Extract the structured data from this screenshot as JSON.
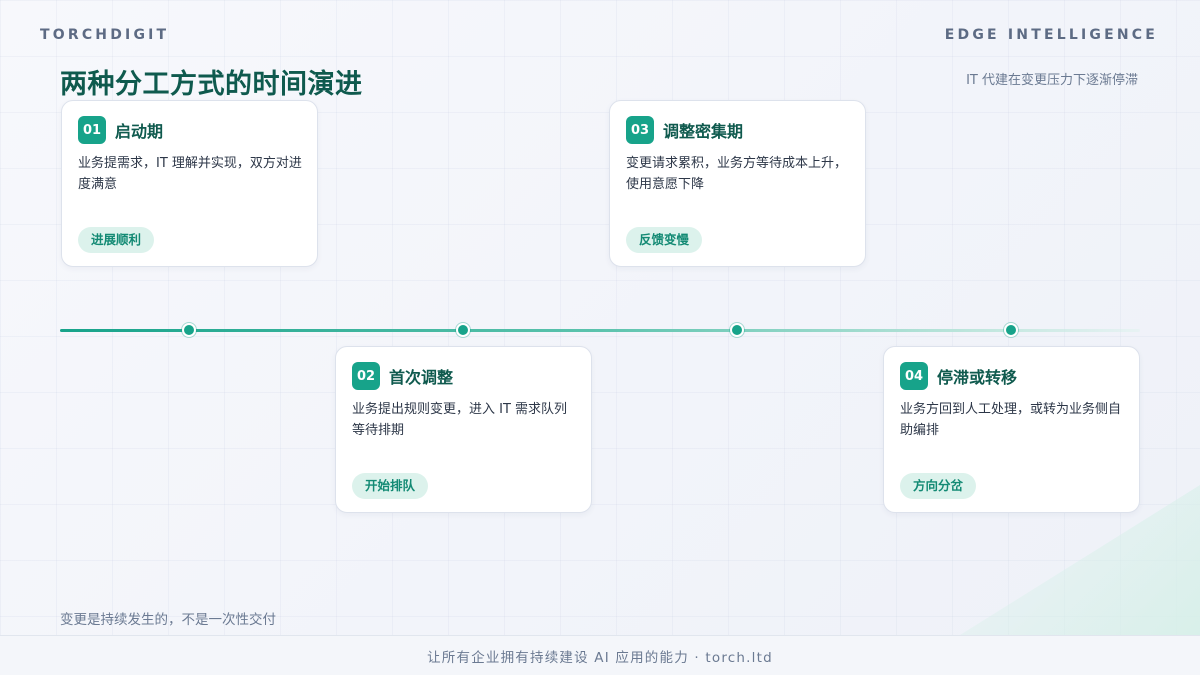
{
  "header": {
    "brand_left": "TORCHDIGIT",
    "brand_right": "EDGE INTELLIGENCE",
    "title": "两种分工方式的时间演进",
    "subtitle": "IT 代建在变更压力下逐渐停滞"
  },
  "timeline": {
    "accent_color": "#17a38a",
    "title_color": "#0f5a4e",
    "stages": [
      {
        "number": "01",
        "title": "启动期",
        "description": "业务提需求，IT 理解并实现，双方对进度满意",
        "tag": "进展顺利",
        "position": "above"
      },
      {
        "number": "02",
        "title": "首次调整",
        "description": "业务提出规则变更，进入 IT 需求队列等待排期",
        "tag": "开始排队",
        "position": "below"
      },
      {
        "number": "03",
        "title": "调整密集期",
        "description": "变更请求累积，业务方等待成本上升，使用意愿下降",
        "tag": "反馈变慢",
        "position": "above"
      },
      {
        "number": "04",
        "title": "停滞或转移",
        "description": "业务方回到人工处理，或转为业务侧自助编排",
        "tag": "方向分岔",
        "position": "below"
      }
    ]
  },
  "bottom_note": "变更是持续发生的，不是一次性交付",
  "footer": {
    "text": "让所有企业拥有持续建设 AI 应用的能力 · torch.ltd"
  }
}
